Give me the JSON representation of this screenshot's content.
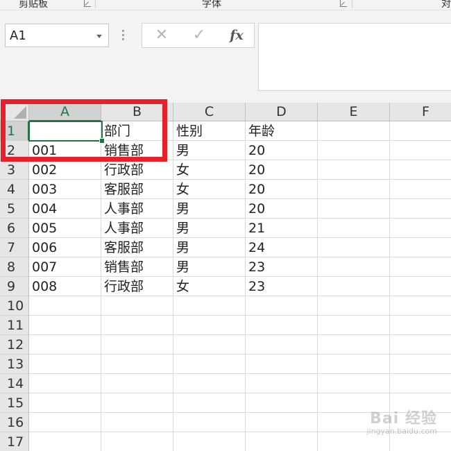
{
  "ribbon": {
    "groups": [
      {
        "label": "剪贴板"
      },
      {
        "label": "字体"
      },
      {
        "label": "对"
      }
    ]
  },
  "name_box": {
    "value": "A1"
  },
  "formula_bar": {
    "cancel_icon": "✕",
    "enter_icon": "✓",
    "function_label": "fx",
    "value": ""
  },
  "grid": {
    "columns": [
      "A",
      "B",
      "C",
      "D",
      "E",
      "F"
    ],
    "rows": [
      "1",
      "2",
      "3",
      "4",
      "5",
      "6",
      "7",
      "8",
      "9",
      "10",
      "11",
      "12",
      "13",
      "14",
      "15",
      "16",
      "17"
    ],
    "cells": [
      [
        "",
        "部门",
        "性别",
        "年龄",
        "",
        ""
      ],
      [
        "001",
        "销售部",
        "男",
        "20",
        "",
        ""
      ],
      [
        "002",
        "行政部",
        "女",
        "20",
        "",
        ""
      ],
      [
        "003",
        "客服部",
        "女",
        "20",
        "",
        ""
      ],
      [
        "004",
        "人事部",
        "男",
        "20",
        "",
        ""
      ],
      [
        "005",
        "人事部",
        "男",
        "21",
        "",
        ""
      ],
      [
        "006",
        "客服部",
        "男",
        "24",
        "",
        ""
      ],
      [
        "007",
        "销售部",
        "男",
        "23",
        "",
        ""
      ],
      [
        "008",
        "行政部",
        "女",
        "23",
        "",
        ""
      ]
    ],
    "active_cell": "A1"
  },
  "watermark": {
    "main": "Bai 经验",
    "sub": "jingyan.baidu.com"
  },
  "colors": {
    "accent": "#217346",
    "highlight": "#e8202a"
  }
}
